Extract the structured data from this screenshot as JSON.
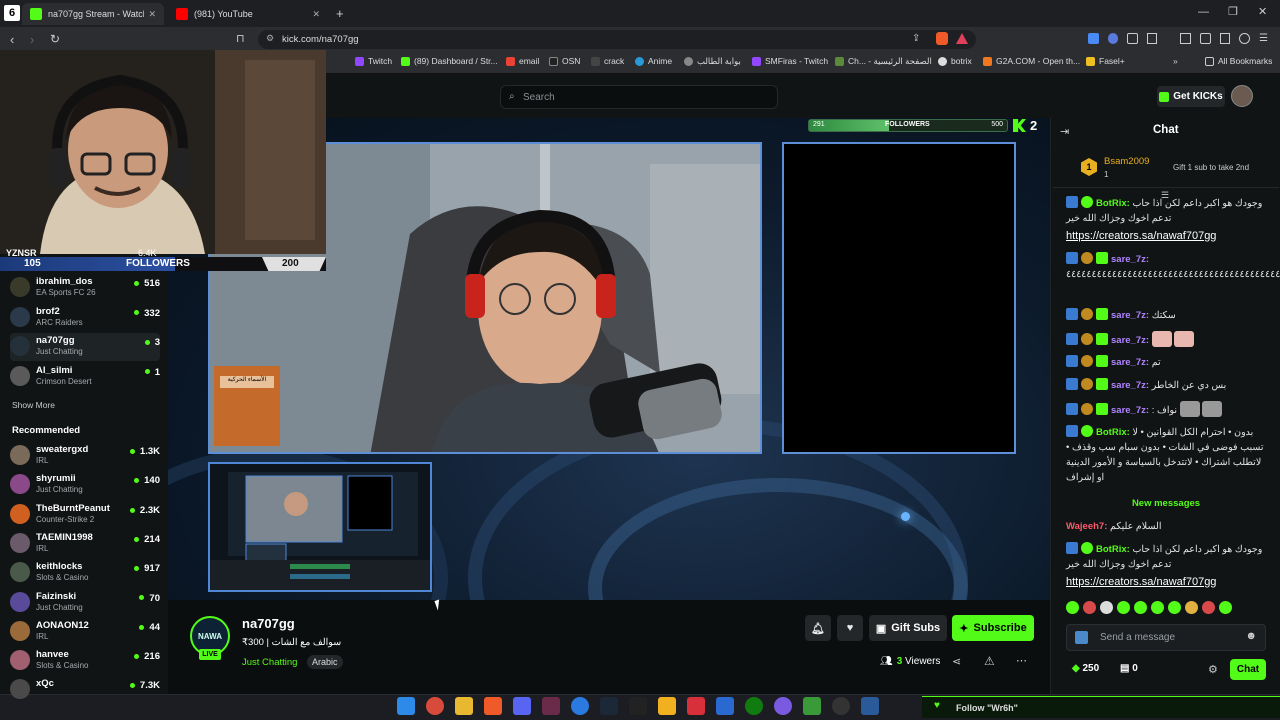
{
  "browser": {
    "tabs": [
      {
        "label": "na707gg Stream - Watch Live o",
        "color": "#53fc18"
      },
      {
        "label": "(981) YouTube",
        "color": "#ff0000"
      }
    ],
    "url": "kick.com/na707gg",
    "bookmarks": [
      "Twitch",
      "(89) Dashboard / Str...",
      "email",
      "OSN",
      "crack",
      "Anime",
      "بوابة الطالب",
      "SMFiras - Twitch",
      "Ch... - الصفحة الرئيسية",
      "botrix",
      "G2A.COM - Open th...",
      "Fasel+",
      "All Bookmarks"
    ]
  },
  "header": {
    "search_placeholder": "Search",
    "get_kicks": "Get KICKs"
  },
  "overlay": {
    "webcam_name": "YZNSR",
    "webcam_views": "6.4K",
    "left_followers_count": "105",
    "left_followers_label": "FOLLOWERS",
    "left_followers_goal": "200",
    "top_followers_count": "291",
    "top_followers_label": "FOLLOWERS",
    "top_followers_goal": "500",
    "kick_badge_count": "2",
    "box_text": "الأسماء الحركية"
  },
  "sidebar": {
    "following": [
      {
        "name": "ibrahim_dos",
        "category": "EA Sports FC 26",
        "viewers": "516",
        "color": "#3a3a2a"
      },
      {
        "name": "brof2",
        "category": "ARC Raiders",
        "viewers": "332",
        "color": "#2a3a4a"
      },
      {
        "name": "na707gg",
        "category": "Just Chatting",
        "viewers": "3",
        "color": "#24303a"
      },
      {
        "name": "Al_silmi",
        "category": "Crimson Desert",
        "viewers": "1",
        "color": "#5a5a5a"
      }
    ],
    "show_more": "Show More",
    "recommended_title": "Recommended",
    "recommended": [
      {
        "name": "sweatergxd",
        "category": "IRL",
        "viewers": "1.3K",
        "color": "#7a6a5a"
      },
      {
        "name": "shyrumii",
        "category": "Just Chatting",
        "viewers": "140",
        "color": "#8a4a8a"
      },
      {
        "name": "TheBurntPeanut",
        "category": "Counter-Strike 2",
        "viewers": "2.3K",
        "color": "#d06020"
      },
      {
        "name": "TAEMIN1998",
        "category": "IRL",
        "viewers": "214",
        "color": "#6a5a6a"
      },
      {
        "name": "keithlocks",
        "category": "Slots & Casino",
        "viewers": "917",
        "color": "#4a5a4a"
      },
      {
        "name": "Faizinski",
        "category": "Just Chatting",
        "viewers": "70",
        "color": "#5a4a9a"
      },
      {
        "name": "AONAON12",
        "category": "IRL",
        "viewers": "44",
        "color": "#9a6a3a"
      },
      {
        "name": "hanvee",
        "category": "Slots & Casino",
        "viewers": "216",
        "color": "#a06070"
      },
      {
        "name": "xQc",
        "category": "",
        "viewers": "7.3K",
        "color": "#4a4a4a"
      }
    ]
  },
  "stream": {
    "channel": "na707gg",
    "live_badge": "LIVE",
    "title": "₹300 | سوالف مع الشات",
    "category": "Just Chatting",
    "tag": "Arabic",
    "gift_subs": "Gift Subs",
    "subscribe": "Subscribe",
    "viewers": "3",
    "viewers_label": "Viewers"
  },
  "chat": {
    "title": "Chat",
    "top_gifter": "Bsam2009",
    "top_gifter_rank": "1",
    "top_gifter_count": "1",
    "gift_prompt": "Gift 1 sub to take 2nd",
    "messages": [
      {
        "user": "BotRix",
        "text": "وجودك هو اكبر داعم لكن اذا حاب تدعم اخوك وجزاك الله خير",
        "link": "https://creators.sa/nawaf707gg",
        "color": "#53fc18"
      },
      {
        "user": "sare_7z",
        "text": "٤٤٤٤٤٤٤٤٤٤٤٤٤٤٤٤٤٤٤٤٤٤٤٤٤٤٤٤٤٤٤٤٤٤٤٤٤٤٤٤٤٤٤٤٤",
        "link": "",
        "color": "#b084ff"
      },
      {
        "user": "sare_7z",
        "text": "سكتك",
        "link": "",
        "color": "#b084ff"
      },
      {
        "user": "sare_7z",
        "text": "",
        "link": "",
        "color": "#b084ff"
      },
      {
        "user": "sare_7z",
        "text": "تم",
        "link": "",
        "color": "#b084ff"
      },
      {
        "user": "sare_7z",
        "text": "بس دي عن الخاطر",
        "link": "",
        "color": "#b084ff"
      },
      {
        "user": "sare_7z",
        "text": "نواف :",
        "link": "",
        "color": "#b084ff"
      },
      {
        "user": "BotRix",
        "text": "بدون • احترام الكل القوانين • لا تسبب فوضى في الشات • بدون سبام سب وقذف • لاتطلب اشتراك • لاتتدخل بالسياسة و الأمور الدينية او إشراف",
        "link": "",
        "color": "#53fc18"
      }
    ],
    "new_messages": "New messages",
    "after": [
      {
        "user": "Wajeeh7",
        "text": "السلام عليكم",
        "color": "#ff5a6a"
      },
      {
        "user": "BotRix",
        "text": "وجودك هو اكبر داعم لكن اذا حاب تدعم اخوك وجزاك الله خير",
        "link": "https://creators.sa/nawaf707gg",
        "color": "#53fc18"
      }
    ],
    "input_placeholder": "Send a message",
    "kicks_balance": "250",
    "points": "0",
    "send": "Chat"
  },
  "taskbar": {
    "notification": "Follow \"Wr6h\""
  }
}
